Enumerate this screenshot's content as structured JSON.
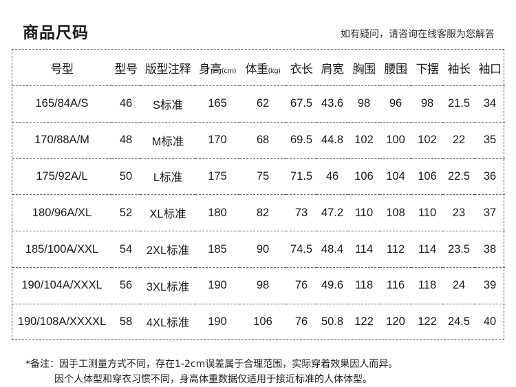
{
  "header": {
    "title": "商品尺码",
    "hint": "如有疑问，请咨询在线客服为您解答"
  },
  "table": {
    "columns": [
      {
        "label": "号型",
        "unit": ""
      },
      {
        "label": "型号",
        "unit": ""
      },
      {
        "label": "版型注释",
        "unit": ""
      },
      {
        "label": "身高",
        "unit": "(cm)"
      },
      {
        "label": "体重",
        "unit": "(kg)"
      },
      {
        "label": "衣长",
        "unit": ""
      },
      {
        "label": "肩宽",
        "unit": ""
      },
      {
        "label": "胸围",
        "unit": ""
      },
      {
        "label": "腰围",
        "unit": ""
      },
      {
        "label": "下摆",
        "unit": ""
      },
      {
        "label": "袖长",
        "unit": ""
      },
      {
        "label": "袖口",
        "unit": ""
      }
    ],
    "rows": [
      [
        "165/84A/S",
        "46",
        "S标准",
        "165",
        "62",
        "67.5",
        "43.6",
        "98",
        "96",
        "98",
        "21.5",
        "34"
      ],
      [
        "170/88A/M",
        "48",
        "M标准",
        "170",
        "68",
        "69.5",
        "44.8",
        "102",
        "100",
        "102",
        "22",
        "35"
      ],
      [
        "175/92A/L",
        "50",
        "L标准",
        "175",
        "75",
        "71.5",
        "46",
        "106",
        "104",
        "106",
        "22.5",
        "36"
      ],
      [
        "180/96A/XL",
        "52",
        "XL标准",
        "180",
        "82",
        "73",
        "47.2",
        "110",
        "108",
        "110",
        "23",
        "37"
      ],
      [
        "185/100A/XXL",
        "54",
        "2XL标准",
        "185",
        "90",
        "74.5",
        "48.4",
        "114",
        "112",
        "114",
        "23.5",
        "38"
      ],
      [
        "190/104A/XXXL",
        "56",
        "3XL标准",
        "190",
        "98",
        "76",
        "49.6",
        "118",
        "116",
        "118",
        "24",
        "39"
      ],
      [
        "190/108A/XXXXL",
        "58",
        "4XL标准",
        "190",
        "106",
        "76",
        "50.8",
        "122",
        "120",
        "122",
        "24.5",
        "40"
      ]
    ]
  },
  "note": {
    "line1": "*备注：因手工测量方式不同，存在1-2cm误差属于合理范围，实际穿着效果因人而异。",
    "line2": "因个人体型和穿衣习惯不同，身高体重数据仅适用于接近标准的人体体型。"
  }
}
